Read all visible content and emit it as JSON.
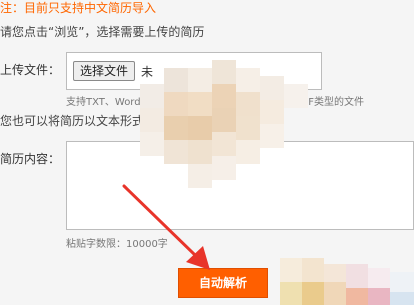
{
  "notice": "注：目前只支持中文简历导入",
  "hint_upload": "请您点击“浏览”，选择需要上传的简历",
  "upload": {
    "label": "上传文件：",
    "browse_label": "选择文件",
    "file_name": "未",
    "support_note": "支持TXT、Word(",
    "support_note_tail": "DF类型的文件"
  },
  "hint_paste": "您也可以将简历以文本形式",
  "content": {
    "label": "简历内容：",
    "limit_note": "粘贴字数限：10000字"
  },
  "parse_button_label": "自动解析",
  "colors": {
    "accent": "#ff5f00",
    "notice": "#ff6600",
    "arrow": "#e8342a"
  }
}
